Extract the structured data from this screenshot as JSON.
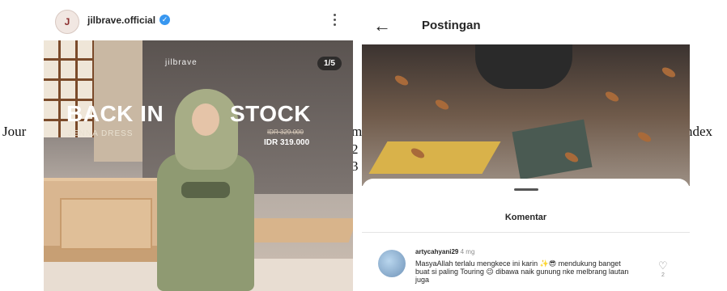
{
  "document": {
    "left_fragment": "Jour",
    "right_fragment": "ndex",
    "mid_fragment_1": "m",
    "mid_fragment_2": "2",
    "mid_fragment_3": "3"
  },
  "instagram_post": {
    "username": "jilbrave.official",
    "avatar_glyph": "J",
    "brand_logo": "jilbrave",
    "slide_counter": "1/5",
    "headline_left": "BACK IN",
    "headline_right": "STOCK",
    "product_name": "JENNA DRESS",
    "price_old": "IDR 329.000",
    "price_new": "IDR 319.000"
  },
  "comments_screen": {
    "header_title": "Postingan",
    "back_glyph": "←",
    "sheet_title": "Komentar",
    "comment": {
      "username": "artycahyani29",
      "time": "4 mg",
      "text": "MasyaAllah terlalu mengkece ini karin ✨😎 mendukung banget buat si paling Touring 😉 dibawa naik gunung nke melbrang lautan juga",
      "likes": "2"
    }
  },
  "colors": {
    "verified": "#3897f0",
    "text_primary": "#262626",
    "text_secondary": "#8e8e8e"
  }
}
